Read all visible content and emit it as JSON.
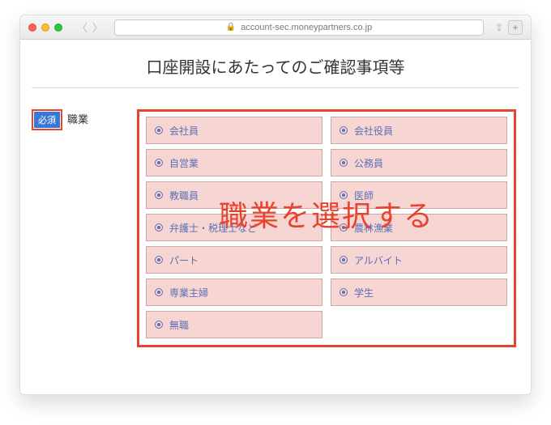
{
  "browser": {
    "url": "account-sec.moneypartners.co.jp"
  },
  "page": {
    "title": "口座開設にあたってのご確認事項等"
  },
  "field": {
    "required_label": "必須",
    "label": "職業"
  },
  "options": [
    "会社員",
    "会社役員",
    "自営業",
    "公務員",
    "教職員",
    "医師",
    "弁護士・税理士など",
    "農林漁業",
    "パート",
    "アルバイト",
    "専業主婦",
    "学生",
    "無職"
  ],
  "overlay": "職業を選択する"
}
